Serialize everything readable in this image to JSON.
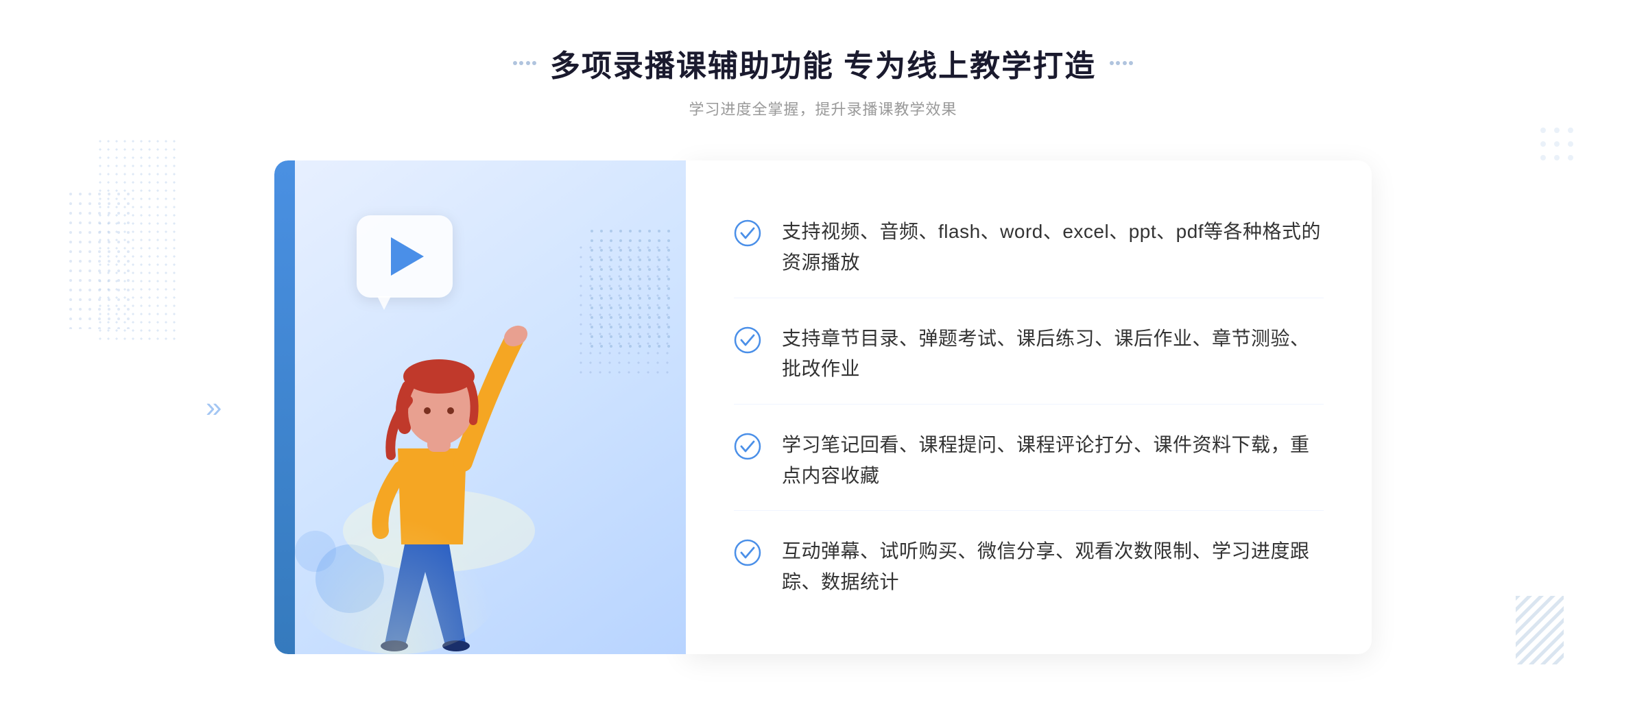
{
  "header": {
    "title": "多项录播课辅助功能 专为线上教学打造",
    "subtitle": "学习进度全掌握，提升录播课教学效果",
    "decoration_left": "decorative-dots",
    "decoration_right": "decorative-dots"
  },
  "features": [
    {
      "id": 1,
      "text": "支持视频、音频、flash、word、excel、ppt、pdf等各种格式的资源播放"
    },
    {
      "id": 2,
      "text": "支持章节目录、弹题考试、课后练习、课后作业、章节测验、批改作业"
    },
    {
      "id": 3,
      "text": "学习笔记回看、课程提问、课程评论打分、课件资料下载，重点内容收藏"
    },
    {
      "id": 4,
      "text": "互动弹幕、试听购买、微信分享、观看次数限制、学习进度跟踪、数据统计"
    }
  ],
  "illustration": {
    "play_button_visible": true
  },
  "colors": {
    "primary_blue": "#4a8fe8",
    "text_dark": "#333333",
    "text_gray": "#999999",
    "title_dark": "#1a1a2e",
    "bg_light_blue": "#e8f0ff",
    "check_color": "#4a8fe8"
  }
}
